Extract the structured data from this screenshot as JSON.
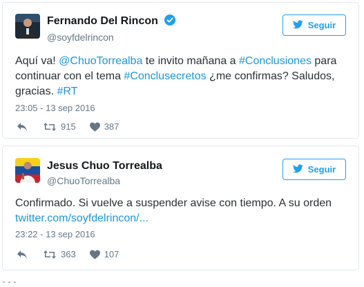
{
  "tweets": [
    {
      "name": "Fernando Del Rincon",
      "verified": true,
      "handle": "@soyfdelrincon",
      "follow_label": "Seguir",
      "text_parts": {
        "p1": "Aquí va! ",
        "mention": "@ChuoTorrealba",
        "p2": " te invito mañana a ",
        "hashtag1": "#Conclusiones",
        "p3": " para continuar con el tema ",
        "hashtag2": "#Conclusecretos",
        "p4": " ¿me confirmas? Saludos, gracias. ",
        "hashtag3": "#RT"
      },
      "timestamp": "23:05 - 13 sep 2016",
      "retweets": "915",
      "likes": "387"
    },
    {
      "name": "Jesus Chuo Torrealba",
      "verified": false,
      "handle": "@ChuoTorrealba",
      "follow_label": "Seguir",
      "text_parts": {
        "p1": "Confirmado. Si vuelve a suspender avise con tiempo. A su orden",
        "link": "twitter.com/soyfdelrincon/..."
      },
      "timestamp": "23:22 - 13 sep 2016",
      "retweets": "363",
      "likes": "107"
    }
  ],
  "colors": {
    "accent": "#1da1f2",
    "link": "#1b95e0",
    "muted": "#657786",
    "border": "#e1e8ed"
  },
  "icons": [
    "avatar",
    "verified-badge-icon",
    "twitter-bird-icon",
    "reply-icon",
    "retweet-icon",
    "heart-icon"
  ]
}
